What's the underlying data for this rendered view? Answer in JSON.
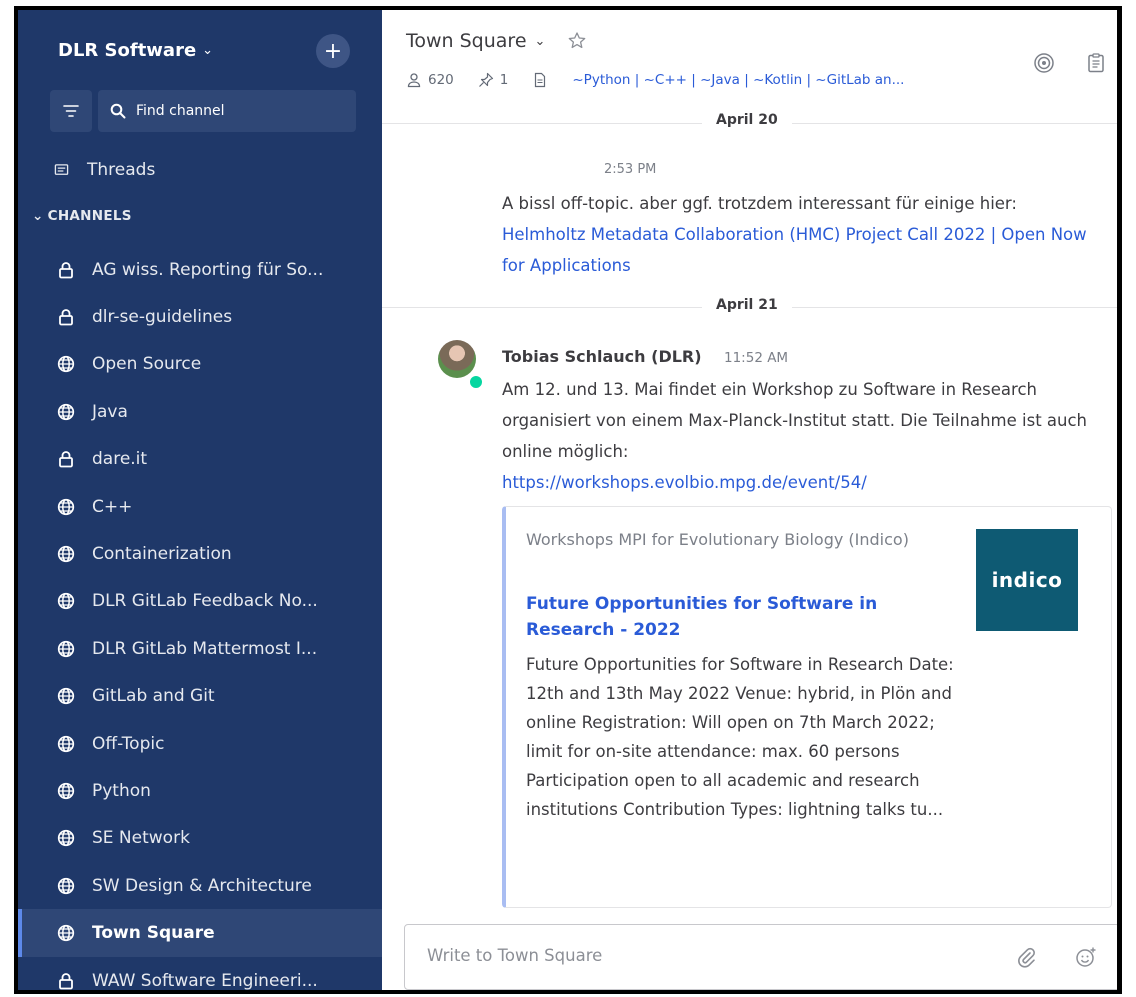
{
  "sidebar": {
    "team_name": "DLR Software",
    "add_label": "+",
    "find_channel": "Find channel",
    "threads_label": "Threads",
    "channels_header": "CHANNELS",
    "channels": [
      {
        "label": "AG wiss. Reporting für So...",
        "icon": "lock-icon"
      },
      {
        "label": "dlr-se-guidelines",
        "icon": "lock-icon"
      },
      {
        "label": "Open Source",
        "icon": "globe-icon"
      },
      {
        "label": "Java",
        "icon": "globe-icon"
      },
      {
        "label": "dare.it",
        "icon": "lock-icon"
      },
      {
        "label": "C++",
        "icon": "globe-icon"
      },
      {
        "label": "Containerization",
        "icon": "globe-icon"
      },
      {
        "label": "DLR GitLab Feedback No...",
        "icon": "globe-icon"
      },
      {
        "label": "DLR GitLab Mattermost I...",
        "icon": "globe-icon"
      },
      {
        "label": "GitLab and Git",
        "icon": "globe-icon"
      },
      {
        "label": "Off-Topic",
        "icon": "globe-icon"
      },
      {
        "label": "Python",
        "icon": "globe-icon"
      },
      {
        "label": "SE Network",
        "icon": "globe-icon"
      },
      {
        "label": "SW Design & Architecture",
        "icon": "globe-icon"
      },
      {
        "label": "Town Square",
        "icon": "globe-icon",
        "active": true
      },
      {
        "label": "WAW Software Engineeri...",
        "icon": "lock-icon"
      }
    ]
  },
  "header": {
    "channel_name": "Town Square",
    "member_count": "620",
    "pinned_count": "1",
    "purpose": "~Python | ~C++ | ~Java | ~Kotlin | ~GitLab an..."
  },
  "messages": {
    "date1": "April 20",
    "msg1_time": "2:53 PM",
    "msg1_text": "A bissl off-topic. aber ggf. trotzdem interessant für einige hier:",
    "msg1_link": "Helmholtz Metadata Collaboration (HMC) Project Call 2022 | Open Now for Applications",
    "date2": "April 21",
    "msg2_author": "Tobias Schlauch (DLR)",
    "msg2_time": "11:52 AM",
    "msg2_text": "Am 12. und 13. Mai findet ein Workshop zu Software in Research organisiert von einem Max-Planck-Institut statt. Die Teilnahme ist auch online möglich:",
    "msg2_link": "https://workshops.evolbio.mpg.de/event/54/",
    "preview": {
      "site": "Workshops MPI for Evolutionary Biology (Indico)",
      "title": "Future Opportunities for Software in Research - 2022",
      "description": "Future Opportunities for Software in Research Date: 12th and 13th May 2022 Venue: hybrid, in Plön and online Registration: Will open on 7th March 2022; limit for on-site attendance: max. 60 persons Participation open to all academic and research institutions Contribution Types: lightning talks tu...",
      "logo_text": "indico"
    }
  },
  "composer": {
    "placeholder": "Write to Town Square"
  },
  "colors": {
    "sidebar_bg": "#1f3869",
    "link": "#2a5bd7",
    "active_indicator": "#5d89ea",
    "online_status": "#06d6a0",
    "logo_bg": "#0e5a73"
  }
}
